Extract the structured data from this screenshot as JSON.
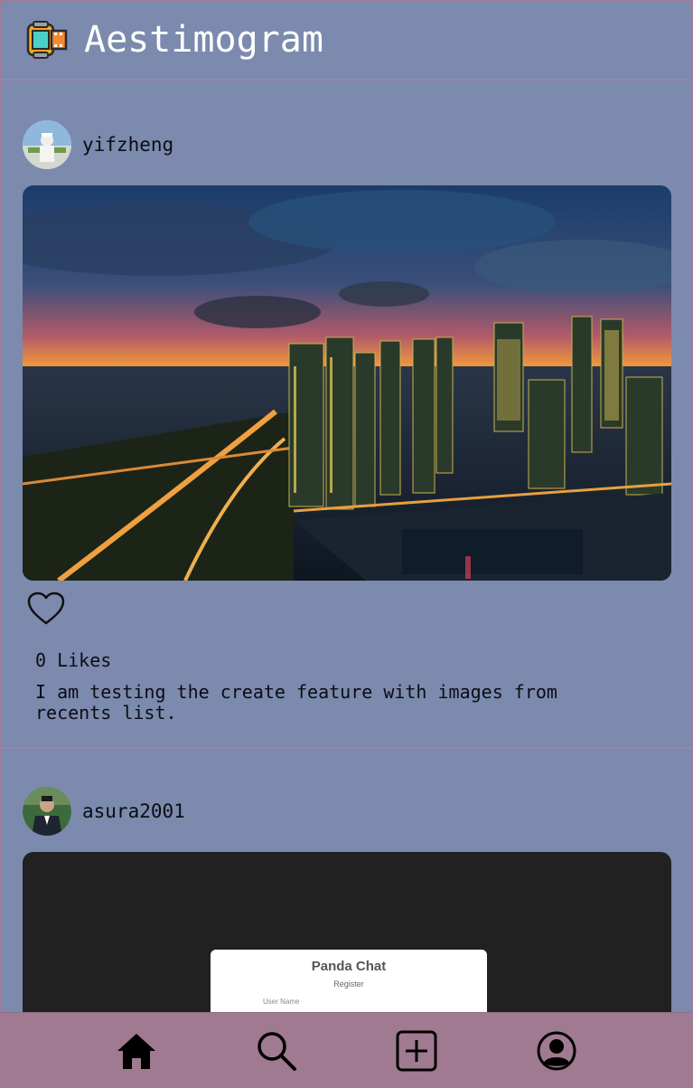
{
  "header": {
    "title": "Aestimogram",
    "logo_icon": "film-canister-icon"
  },
  "posts": [
    {
      "username": "yifzheng",
      "likes_label": "0 Likes",
      "caption": "I am testing the create feature with images from recents list.",
      "image_desc": "city-skyline-sunset-photo"
    },
    {
      "username": "asura2001",
      "image_card": {
        "title": "Panda Chat",
        "subtitle": "Register",
        "field_label": "User Name"
      }
    }
  ],
  "nav": {
    "items": [
      {
        "icon": "home-icon"
      },
      {
        "icon": "search-icon"
      },
      {
        "icon": "add-post-icon"
      },
      {
        "icon": "profile-icon"
      }
    ]
  },
  "colors": {
    "background": "#7b8aad",
    "nav_background": "#a07a90",
    "divider": "#9c84a6",
    "title_text": "#ffffff"
  }
}
